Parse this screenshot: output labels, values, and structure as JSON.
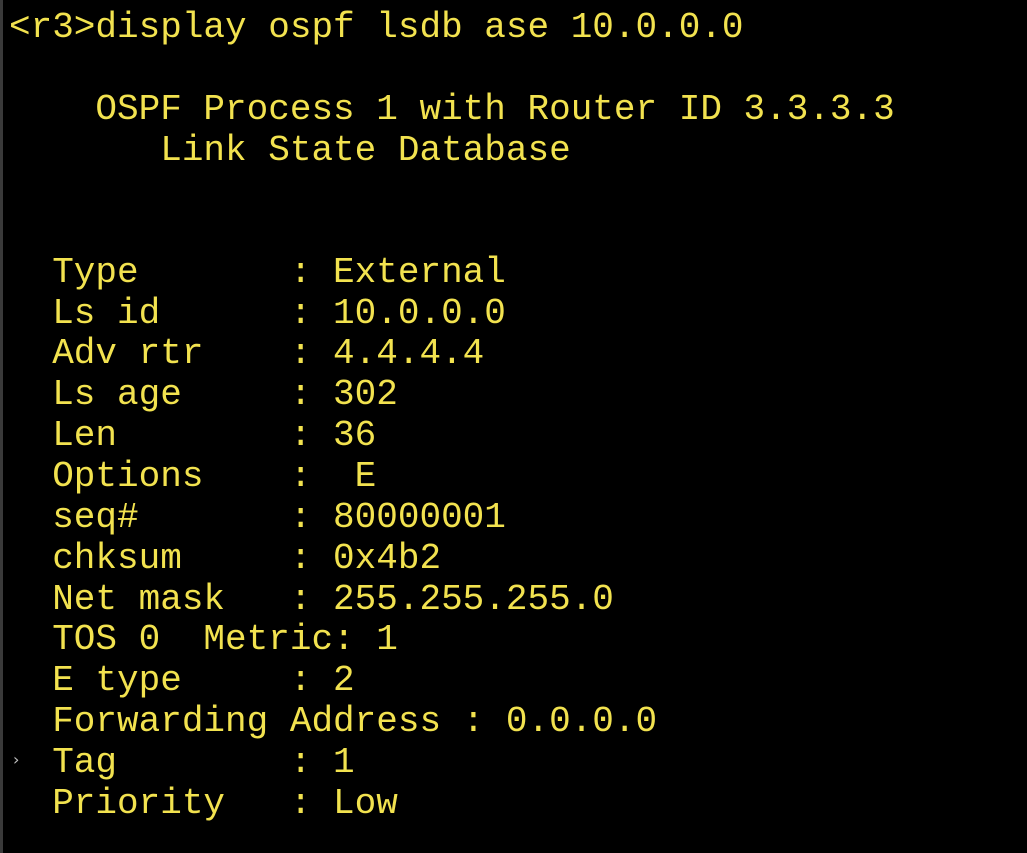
{
  "terminal": {
    "text_color": "#f2e24f",
    "background_color": "#000000",
    "prompt_line": "<r3>display ospf lsdb ase 10.0.0.0",
    "header_line1": "    OSPF Process 1 with Router ID 3.3.3.3",
    "header_line2": "       Link State Database",
    "lines": [
      "  Type       : External",
      "  Ls id      : 10.0.0.0",
      "  Adv rtr    : 4.4.4.4",
      "  Ls age     : 302",
      "  Len        : 36",
      "  Options    :  E",
      "  seq#       : 80000001",
      "  chksum     : 0x4b2",
      "  Net mask   : 255.255.255.0",
      "  TOS 0  Metric: 1",
      "  E type     : 2",
      "  Forwarding Address : 0.0.0.0",
      "  Tag        : 1",
      "  Priority   : Low"
    ],
    "side_marker": "›"
  }
}
